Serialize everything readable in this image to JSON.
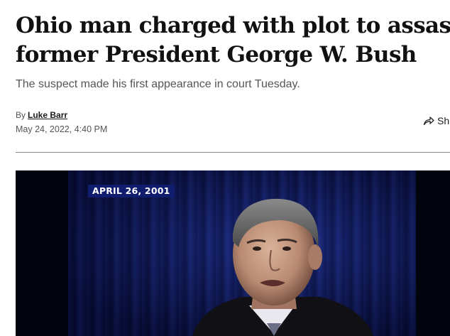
{
  "article": {
    "headline_line1": "Ohio man charged with plot to assassinate",
    "headline_line2": "former President George W. Bush",
    "subhead": "The suspect made his first appearance in court Tuesday.",
    "byline_prefix": "By",
    "author": "Luke Barr",
    "date": "May 24, 2022, 4:40 PM"
  },
  "share": {
    "label": "Sh",
    "icon": "share-arrow-icon"
  },
  "video": {
    "overlay_date": "APRIL 26, 2001"
  },
  "colors": {
    "headline": "#111111",
    "subtext": "#555555",
    "overlay_bg": "#101c6e",
    "video_bg": "#02040d"
  }
}
